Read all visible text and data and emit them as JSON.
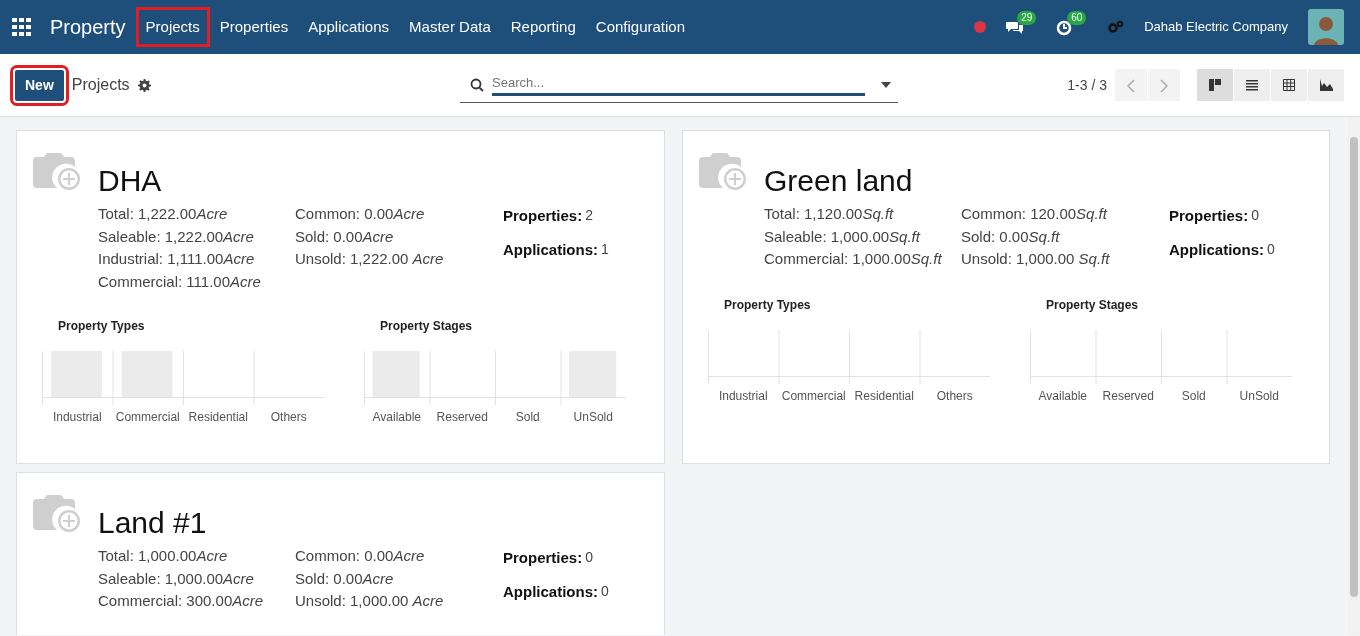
{
  "navbar": {
    "app_name": "Property",
    "menu": [
      {
        "label": "Projects",
        "highlighted": true
      },
      {
        "label": "Properties",
        "highlighted": false
      },
      {
        "label": "Applications",
        "highlighted": false
      },
      {
        "label": "Master Data",
        "highlighted": false
      },
      {
        "label": "Reporting",
        "highlighted": false
      },
      {
        "label": "Configuration",
        "highlighted": false
      }
    ],
    "messages_count": "29",
    "activities_count": "60",
    "company": "Dahab Electric Company"
  },
  "control_panel": {
    "new_button": {
      "label": "New",
      "highlighted": true
    },
    "breadcrumb": "Projects",
    "search": {
      "placeholder": "Search..."
    },
    "pager": "1-3 / 3",
    "views": [
      {
        "kind": "kanban",
        "selected": true
      },
      {
        "kind": "list",
        "selected": false
      },
      {
        "kind": "pivot",
        "selected": false
      },
      {
        "kind": "graph",
        "selected": false
      }
    ]
  },
  "projects": [
    {
      "name": "DHA",
      "stats_left": [
        {
          "value": "Total: 1,222.00",
          "unit": "Acre"
        },
        {
          "value": "Saleable: 1,222.00",
          "unit": "Acre"
        },
        {
          "value": "Industrial: 1,111.00",
          "unit": "Acre"
        },
        {
          "value": "Commercial: 111.00",
          "unit": "Acre"
        }
      ],
      "stats_mid": [
        {
          "value": "Common: 0.00",
          "unit": "Acre"
        },
        {
          "value": "Sold: 0.00",
          "unit": "Acre"
        },
        {
          "value": "Unsold: 1,222.00 ",
          "unit": "Acre"
        }
      ],
      "counts": [
        {
          "label": "Properties:",
          "value": "2"
        },
        {
          "label": "Applications:",
          "value": "1"
        }
      ],
      "charts": [
        {
          "title": "Property Types",
          "bars": [
            {
              "label": "Industrial",
              "filled": true
            },
            {
              "label": "Commercial",
              "filled": true
            },
            {
              "label": "Residential",
              "filled": false
            },
            {
              "label": "Others",
              "filled": false
            }
          ]
        },
        {
          "title": "Property Stages",
          "bars": [
            {
              "label": "Available",
              "filled": true
            },
            {
              "label": "Reserved",
              "filled": false
            },
            {
              "label": "Sold",
              "filled": false
            },
            {
              "label": "UnSold",
              "filled": true
            }
          ]
        }
      ]
    },
    {
      "name": "Green land",
      "stats_left": [
        {
          "value": "Total: 1,120.00",
          "unit": "Sq.ft"
        },
        {
          "value": "Saleable: 1,000.00",
          "unit": "Sq.ft"
        },
        {
          "value": "Commercial: 1,000.00",
          "unit": "Sq.ft"
        }
      ],
      "stats_mid": [
        {
          "value": "Common: 120.00",
          "unit": "Sq.ft"
        },
        {
          "value": "Sold: 0.00",
          "unit": "Sq.ft"
        },
        {
          "value": "Unsold: 1,000.00 ",
          "unit": "Sq.ft"
        }
      ],
      "counts": [
        {
          "label": "Properties:",
          "value": "0"
        },
        {
          "label": "Applications:",
          "value": "0"
        }
      ],
      "charts": [
        {
          "title": "Property Types",
          "bars": [
            {
              "label": "Industrial",
              "filled": false
            },
            {
              "label": "Commercial",
              "filled": false
            },
            {
              "label": "Residential",
              "filled": false
            },
            {
              "label": "Others",
              "filled": false
            }
          ]
        },
        {
          "title": "Property Stages",
          "bars": [
            {
              "label": "Available",
              "filled": false
            },
            {
              "label": "Reserved",
              "filled": false
            },
            {
              "label": "Sold",
              "filled": false
            },
            {
              "label": "UnSold",
              "filled": false
            }
          ]
        }
      ]
    },
    {
      "name": "Land #1",
      "stats_left": [
        {
          "value": "Total: 1,000.00",
          "unit": "Acre"
        },
        {
          "value": "Saleable: 1,000.00",
          "unit": "Acre"
        },
        {
          "value": "Commercial: 300.00",
          "unit": "Acre"
        }
      ],
      "stats_mid": [
        {
          "value": "Common: 0.00",
          "unit": "Acre"
        },
        {
          "value": "Sold: 0.00",
          "unit": "Acre"
        },
        {
          "value": "Unsold: 1,000.00 ",
          "unit": "Acre"
        }
      ],
      "counts": [
        {
          "label": "Properties:",
          "value": "0"
        },
        {
          "label": "Applications:",
          "value": "0"
        }
      ]
    }
  ]
}
